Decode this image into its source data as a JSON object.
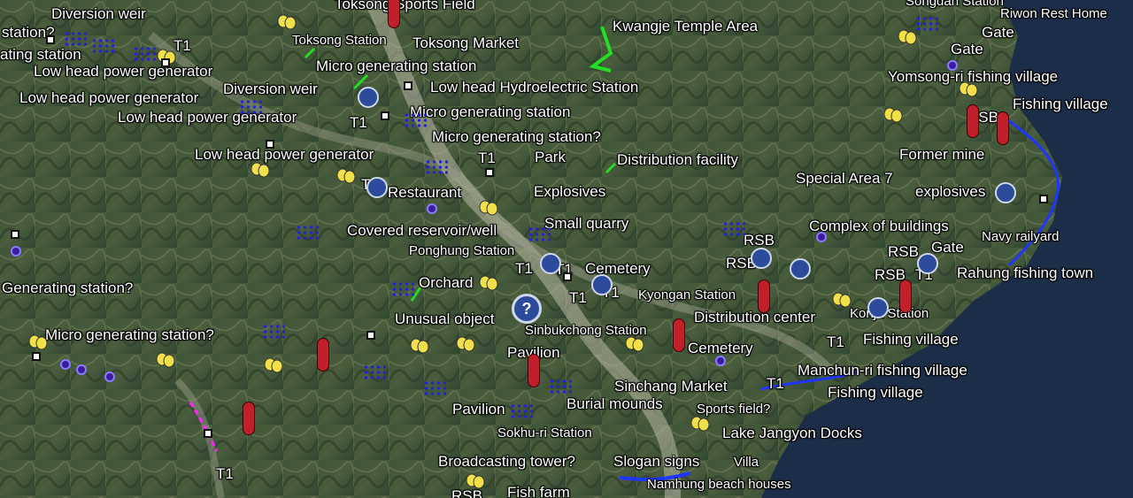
{
  "map": {
    "labels": [
      {
        "text": "Diversion weir"
      },
      {
        "text": "station?"
      },
      {
        "text": "ating station"
      },
      {
        "text": "Low head power generator"
      },
      {
        "text": "Low head power generator"
      },
      {
        "text": "Low head power generator"
      },
      {
        "text": "Diversion weir"
      },
      {
        "text": "Low head power generator"
      },
      {
        "text": "Toksong Sports Field"
      },
      {
        "text": "Toksong Station"
      },
      {
        "text": "Toksong Market"
      },
      {
        "text": "Micro generating station"
      },
      {
        "text": "Low head Hydroelectric Station"
      },
      {
        "text": "Micro generating station"
      },
      {
        "text": "Micro generating station?"
      },
      {
        "text": "Kwangje Temple Area"
      },
      {
        "text": "Park"
      },
      {
        "text": "Distribution facility"
      },
      {
        "text": "Restaurant"
      },
      {
        "text": "Explosives"
      },
      {
        "text": "Small quarry"
      },
      {
        "text": "Covered reservoir/well"
      },
      {
        "text": "Ponghung Station"
      },
      {
        "text": "Cemetery"
      },
      {
        "text": "Orchard"
      },
      {
        "text": "Kyongan Station"
      },
      {
        "text": "Unusual object"
      },
      {
        "text": "Distribution center"
      },
      {
        "text": "Sinbukchong Station"
      },
      {
        "text": "Pavilion"
      },
      {
        "text": "Cemetery"
      },
      {
        "text": "Sinchang Market"
      },
      {
        "text": "Burial mounds"
      },
      {
        "text": "Sports field?"
      },
      {
        "text": "Pavilion"
      },
      {
        "text": "Sokhu-ri Station"
      },
      {
        "text": "Lake Jangyon Docks"
      },
      {
        "text": "Broadcasting tower?"
      },
      {
        "text": "Slogan signs"
      },
      {
        "text": "Villa"
      },
      {
        "text": "Fish farm"
      },
      {
        "text": "Namhung beach houses"
      },
      {
        "text": "Generating station?"
      },
      {
        "text": "Micro generating station?"
      },
      {
        "text": "Yomsong-ri fishing village"
      },
      {
        "text": "Fishing village"
      },
      {
        "text": "Former mine"
      },
      {
        "text": "Special Area 7"
      },
      {
        "text": "explosives"
      },
      {
        "text": "Complex of buildings"
      },
      {
        "text": "Navy railyard"
      },
      {
        "text": "Gate"
      },
      {
        "text": "Rahung fishing town"
      },
      {
        "text": "Konja Station"
      },
      {
        "text": "Fishing village"
      },
      {
        "text": "Manchun-ri fishing village"
      },
      {
        "text": "Fishing village"
      },
      {
        "text": "Riwon Rest Home"
      },
      {
        "text": "Gate"
      },
      {
        "text": "Gate"
      },
      {
        "text": "Songdan Station"
      },
      {
        "text": "RSB"
      },
      {
        "text": "RSB"
      },
      {
        "text": "RSB"
      },
      {
        "text": "RSB"
      },
      {
        "text": "RSB"
      },
      {
        "text": "RSB"
      },
      {
        "text": "T1"
      },
      {
        "text": "T1"
      },
      {
        "text": "T1"
      },
      {
        "text": "T1"
      },
      {
        "text": "T1"
      },
      {
        "text": "T1"
      },
      {
        "text": "T1"
      },
      {
        "text": "T1"
      },
      {
        "text": "T1"
      },
      {
        "text": "T1"
      },
      {
        "text": "T1"
      },
      {
        "text": "T1"
      }
    ],
    "colors": {
      "sea": "#1c2d48",
      "land": "#3b5234",
      "ridge": "#6e7a5a",
      "river": "#b9b9a6",
      "coast_line": "#1f36ff"
    }
  }
}
